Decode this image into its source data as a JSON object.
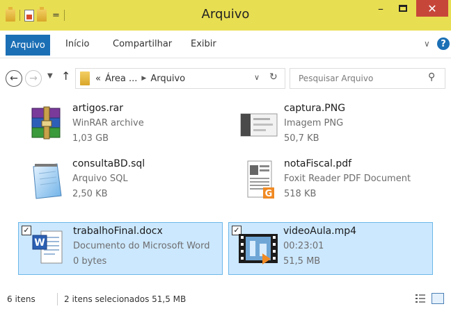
{
  "window": {
    "title": "Arquivo",
    "quick_access_arrow": "=",
    "min_glyph": "–",
    "close_glyph": "✕"
  },
  "ribbon": {
    "tabs": [
      {
        "label": "Arquivo",
        "active": true
      },
      {
        "label": "Início"
      },
      {
        "label": "Compartilhar"
      },
      {
        "label": "Exibir"
      }
    ],
    "help_glyph": "?"
  },
  "navigation": {
    "breadcrumb": {
      "overflow": "«",
      "parts": [
        "Área ...",
        "Arquivo"
      ],
      "separator": "▶"
    },
    "search": {
      "placeholder": "Pesquisar Arquivo"
    }
  },
  "files": [
    {
      "name": "artigos.rar",
      "type": "WinRAR archive",
      "size": "1,03 GB",
      "icon": "winrar-archive-icon",
      "selected": false
    },
    {
      "name": "captura.PNG",
      "type": "Imagem PNG",
      "size": "50,7 KB",
      "icon": "png-thumbnail-icon",
      "selected": false
    },
    {
      "name": "consultaBD.sql",
      "type": "Arquivo SQL",
      "size": "2,50 KB",
      "icon": "notepad-document-icon",
      "selected": false
    },
    {
      "name": "notaFiscal.pdf",
      "type": "Foxit Reader PDF Document",
      "size": "518 KB",
      "icon": "foxit-pdf-icon",
      "selected": false
    },
    {
      "name": "trabalhoFinal.docx",
      "type": "Documento do Microsoft Word",
      "size": "0 bytes",
      "icon": "word-document-icon",
      "selected": true
    },
    {
      "name": "videoAula.mp4",
      "type": "00:23:01",
      "size": "51,5 MB",
      "icon": "video-thumbnail-icon",
      "selected": true
    }
  ],
  "status": {
    "item_count": "6 itens",
    "selection": "2 itens selecionados  51,5 MB"
  },
  "colors": {
    "titlebar": "#e8de52",
    "accent": "#1b6fb5",
    "close": "#c7463a",
    "selection_bg": "#cce8ff",
    "selection_border": "#6cb7e8"
  }
}
